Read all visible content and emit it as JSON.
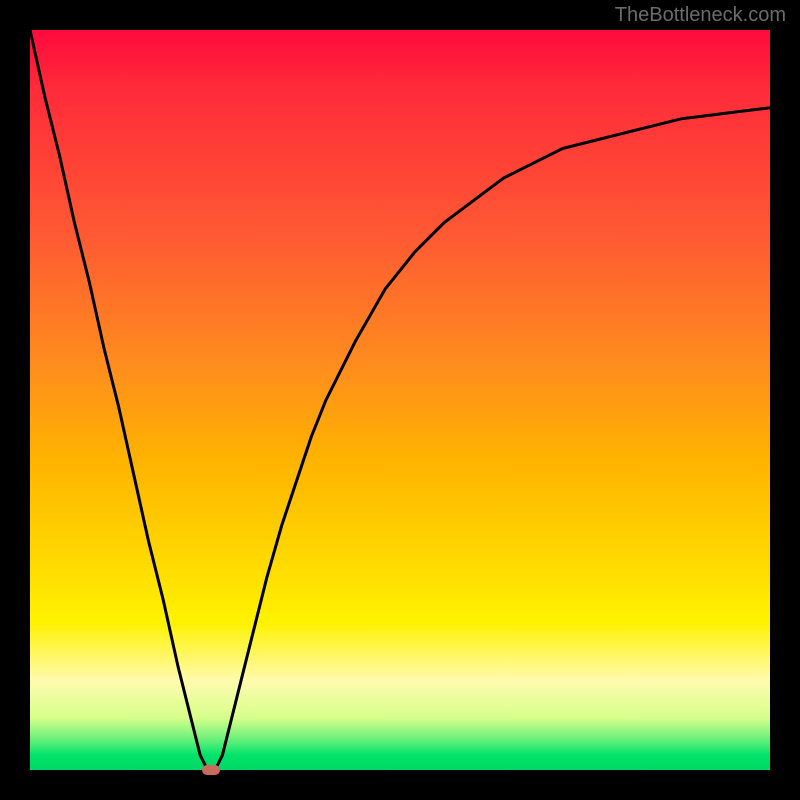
{
  "watermark": "TheBottleneck.com",
  "colors": {
    "frame": "#000000",
    "curve": "#000000",
    "marker": "#cb6a5e"
  },
  "chart_data": {
    "type": "line",
    "title": "",
    "xlabel": "",
    "ylabel": "",
    "xlim": [
      0,
      100
    ],
    "ylim": [
      0,
      100
    ],
    "grid": false,
    "legend": false,
    "series": [
      {
        "name": "bottleneck-curve",
        "x": [
          0,
          2,
          4,
          6,
          8,
          10,
          12,
          14,
          16,
          18,
          20,
          22,
          23,
          24,
          25,
          26,
          27,
          28,
          30,
          32,
          34,
          36,
          38,
          40,
          44,
          48,
          52,
          56,
          60,
          64,
          68,
          72,
          76,
          80,
          84,
          88,
          92,
          96,
          100
        ],
        "y": [
          100,
          91,
          83,
          74,
          66,
          57,
          49,
          40,
          31,
          23,
          14,
          6,
          2,
          0,
          0,
          2,
          6,
          10,
          18,
          26,
          33,
          39,
          45,
          50,
          58,
          65,
          70,
          74,
          77,
          80,
          82,
          84,
          85,
          86,
          87,
          88,
          88.5,
          89,
          89.5
        ]
      }
    ],
    "marker": {
      "x": 24.5,
      "y": 0
    },
    "gradient_stops": [
      {
        "pos": 0.0,
        "color": "#ff0a3c"
      },
      {
        "pos": 0.28,
        "color": "#ff5a33"
      },
      {
        "pos": 0.58,
        "color": "#ffb300"
      },
      {
        "pos": 0.8,
        "color": "#fff200"
      },
      {
        "pos": 0.93,
        "color": "#d6ff8a"
      },
      {
        "pos": 1.0,
        "color": "#00d864"
      }
    ]
  }
}
